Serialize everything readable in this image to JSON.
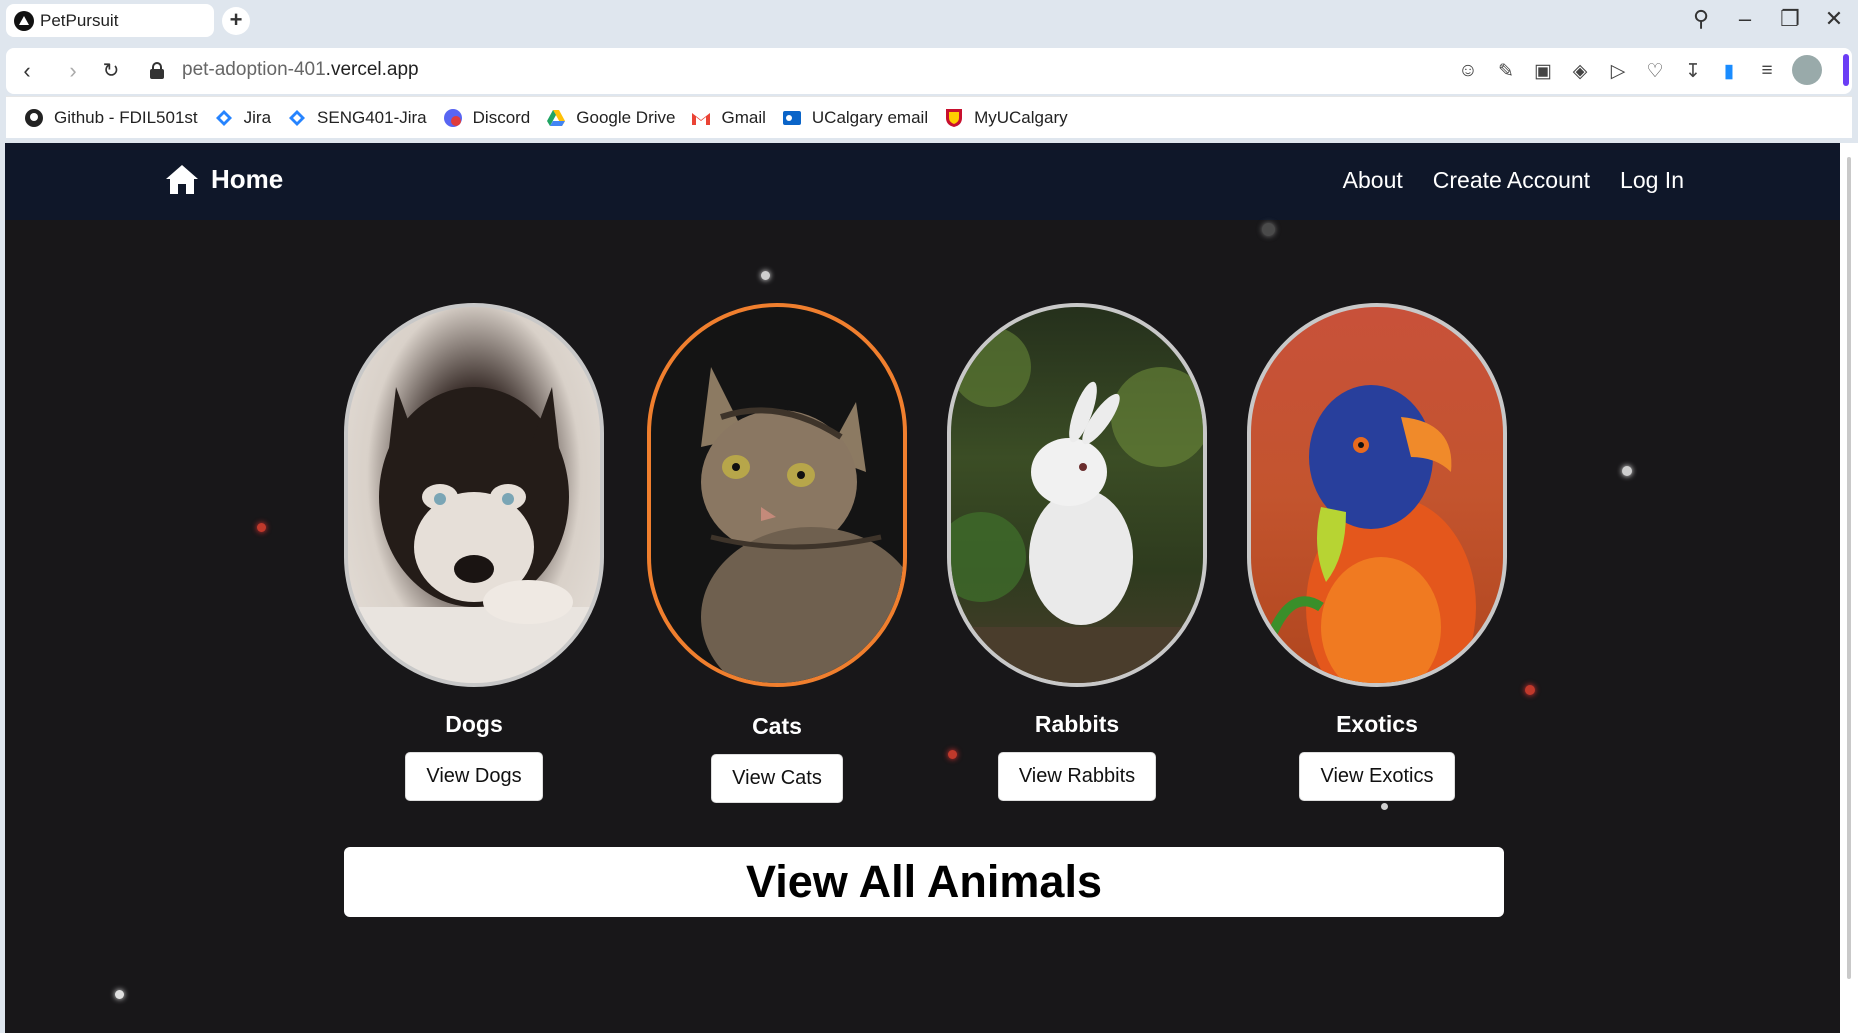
{
  "browser": {
    "tab_title": "PetPursuit",
    "new_tab": "+",
    "url_host": "pet-adoption-401",
    "url_domain": ".vercel.app",
    "bookmarks": [
      {
        "label": "Github - FDIL501st",
        "icon": "github-icon",
        "color": "#222222"
      },
      {
        "label": "Jira",
        "icon": "jira-icon",
        "color": "#2684ff"
      },
      {
        "label": "SENG401-Jira",
        "icon": "jira-icon",
        "color": "#2684ff"
      },
      {
        "label": "Discord",
        "icon": "discord-icon",
        "color": "#e03c3c"
      },
      {
        "label": "Google Drive",
        "icon": "google-drive-icon",
        "color": "#1fa463"
      },
      {
        "label": "Gmail",
        "icon": "gmail-icon",
        "color": "#ea4335"
      },
      {
        "label": "UCalgary email",
        "icon": "outlook-icon",
        "color": "#0a64c8"
      },
      {
        "label": "MyUCalgary",
        "icon": "ucalgary-crest-icon",
        "color": "#c8102e"
      }
    ]
  },
  "site": {
    "nav": {
      "home": "Home",
      "about": "About",
      "create_account": "Create Account",
      "log_in": "Log In"
    },
    "categories": [
      {
        "title": "Dogs",
        "button": "View Dogs",
        "image": "husky-puppy-photo"
      },
      {
        "title": "Cats",
        "button": "View Cats",
        "image": "tabby-cat-photo"
      },
      {
        "title": "Rabbits",
        "button": "View Rabbits",
        "image": "white-rabbit-photo"
      },
      {
        "title": "Exotics",
        "button": "View Exotics",
        "image": "lorikeet-parrot-photo"
      }
    ],
    "view_all": "View All Animals",
    "colors": {
      "nav_bg": "#0f1729",
      "page_bg": "#181719",
      "active_border": "#f07f2e"
    }
  }
}
